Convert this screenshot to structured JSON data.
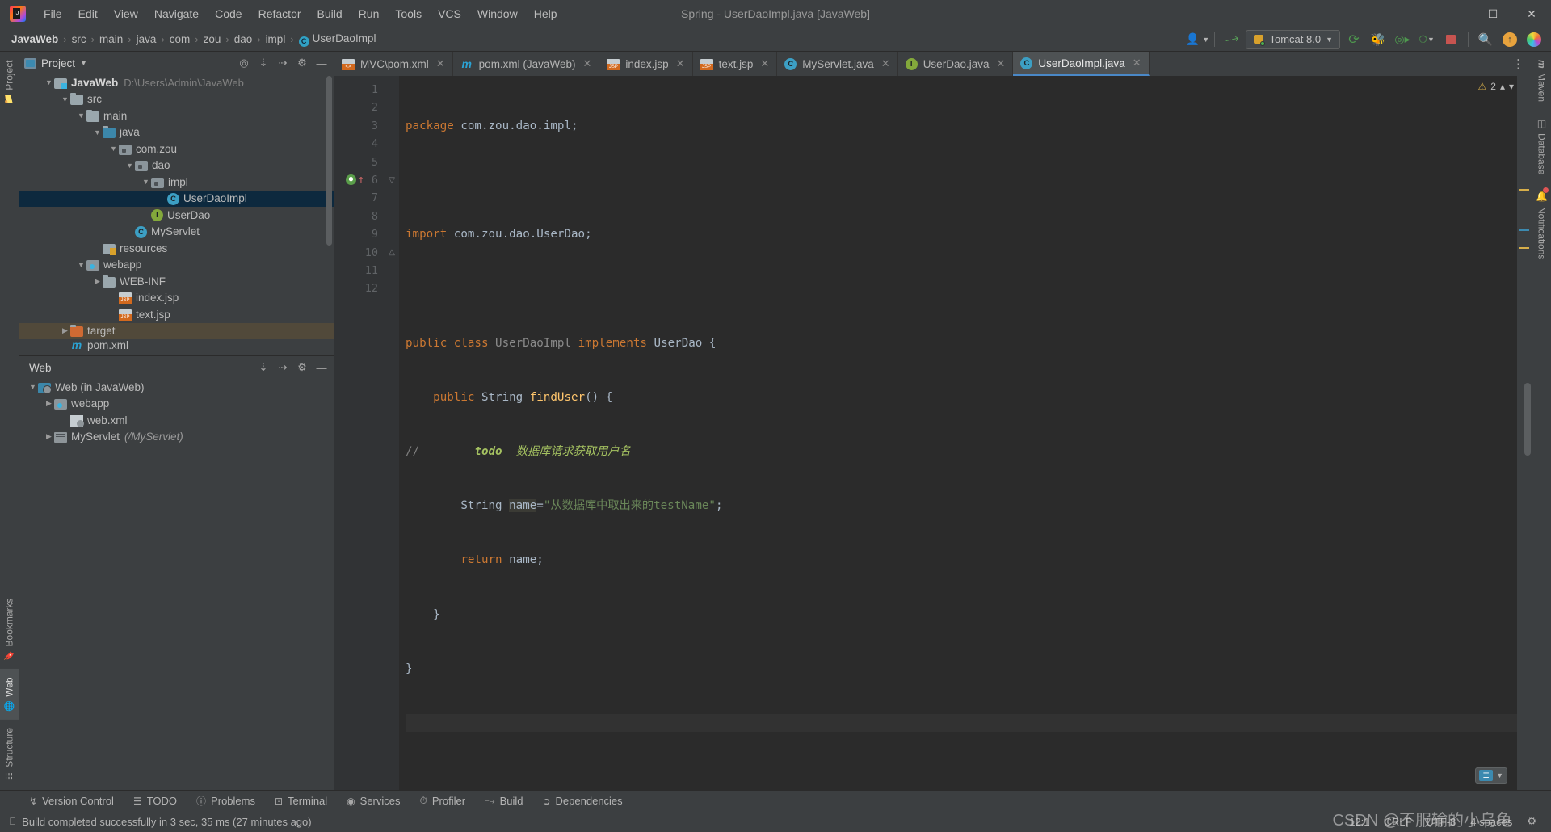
{
  "window": {
    "title": "Spring - UserDaoImpl.java [JavaWeb]",
    "logo_icon": "intellij-idea-logo",
    "minimize_icon": "minimize-icon",
    "maximize_icon": "maximize-icon",
    "close_icon": "close-icon"
  },
  "menubar": {
    "items": [
      {
        "label": "File"
      },
      {
        "label": "Edit"
      },
      {
        "label": "View"
      },
      {
        "label": "Navigate"
      },
      {
        "label": "Code"
      },
      {
        "label": "Refactor"
      },
      {
        "label": "Build"
      },
      {
        "label": "Run"
      },
      {
        "label": "Tools"
      },
      {
        "label": "VCS"
      },
      {
        "label": "Window"
      },
      {
        "label": "Help"
      }
    ]
  },
  "breadcrumb": {
    "items": [
      "JavaWeb",
      "src",
      "main",
      "java",
      "com",
      "zou",
      "dao",
      "impl"
    ],
    "current_file": "UserDaoImpl",
    "current_file_icon_letter": "C",
    "separator": "›"
  },
  "toolbar": {
    "user_icon": "user-account-icon",
    "build_icon": "build-hammer-icon",
    "run_config": {
      "label": "Tomcat 8.0",
      "icon": "tomcat-cat-icon",
      "dropdown_icon": "chevron-down-icon"
    },
    "actions": [
      {
        "name": "run-icon",
        "glyph": "⟳"
      },
      {
        "name": "debug-icon",
        "glyph": "⚙"
      },
      {
        "name": "run-with-coverage-icon",
        "glyph": "▶"
      },
      {
        "name": "profiler-icon",
        "glyph": "◴"
      },
      {
        "name": "stop-icon",
        "glyph": "■"
      },
      {
        "name": "search-everywhere-icon",
        "glyph": "⌕"
      },
      {
        "name": "update-icon",
        "glyph": "↑"
      },
      {
        "name": "idea-assistant-icon",
        "glyph": ""
      }
    ]
  },
  "left_strip": {
    "top": [
      {
        "label": "Project",
        "icon": "project-folder-icon",
        "active": false
      }
    ],
    "bottom": [
      {
        "label": "Bookmarks",
        "icon": "bookmark-icon",
        "active": false
      },
      {
        "label": "Web",
        "icon": "web-globe-icon",
        "active": true
      },
      {
        "label": "Structure",
        "icon": "structure-icon",
        "active": false
      }
    ]
  },
  "right_strip": {
    "items": [
      {
        "label": "Maven",
        "icon": "maven-m-icon",
        "badge": false
      },
      {
        "label": "Database",
        "icon": "database-icon",
        "badge": false
      },
      {
        "label": "Notifications",
        "icon": "bell-icon",
        "badge": true
      }
    ]
  },
  "project_panel": {
    "title": "Project",
    "title_icon": "project-window-icon",
    "dropdown_icon": "chevron-down-icon",
    "actions": [
      {
        "name": "select-opened-file-icon",
        "glyph": "⊕"
      },
      {
        "name": "expand-all-icon",
        "glyph": "⤓"
      },
      {
        "name": "collapse-all-icon",
        "glyph": "⤒"
      },
      {
        "name": "settings-gear-icon",
        "glyph": "⚙"
      },
      {
        "name": "hide-panel-icon",
        "glyph": "—"
      }
    ],
    "tree": [
      {
        "label": "JavaWeb",
        "path": "D:\\Users\\Admin\\JavaWeb",
        "depth": 0,
        "arrow": "down",
        "icon": "module-icon",
        "bold": true
      },
      {
        "label": "src",
        "depth": 1,
        "arrow": "down",
        "icon": "folder-icon"
      },
      {
        "label": "main",
        "depth": 2,
        "arrow": "down",
        "icon": "folder-icon"
      },
      {
        "label": "java",
        "depth": 3,
        "arrow": "down",
        "icon": "source-folder-icon"
      },
      {
        "label": "com.zou",
        "depth": 4,
        "arrow": "down",
        "icon": "package-icon"
      },
      {
        "label": "dao",
        "depth": 5,
        "arrow": "down",
        "icon": "package-icon"
      },
      {
        "label": "impl",
        "depth": 6,
        "arrow": "down",
        "icon": "package-icon"
      },
      {
        "label": "UserDaoImpl",
        "depth": 7,
        "arrow": "none",
        "icon": "java-class-icon",
        "selected": true
      },
      {
        "label": "UserDao",
        "depth": 6,
        "arrow": "none",
        "icon": "java-interface-icon"
      },
      {
        "label": "MyServlet",
        "depth": 5,
        "arrow": "none",
        "icon": "java-class-icon"
      },
      {
        "label": "resources",
        "depth": 3,
        "arrow": "none",
        "icon": "resources-folder-icon"
      },
      {
        "label": "webapp",
        "depth": 3,
        "arrow": "down",
        "icon": "webapp-folder-icon"
      },
      {
        "label": "WEB-INF",
        "depth": 4,
        "arrow": "right",
        "icon": "folder-icon"
      },
      {
        "label": "index.jsp",
        "depth": 4,
        "arrow": "none",
        "icon": "jsp-file-icon"
      },
      {
        "label": "text.jsp",
        "depth": 4,
        "arrow": "none",
        "icon": "jsp-file-icon"
      },
      {
        "label": "target",
        "depth": 1,
        "arrow": "right",
        "icon": "excluded-folder-icon",
        "excluded": true
      },
      {
        "label": "pom.xml",
        "depth": 1,
        "arrow": "none",
        "icon": "maven-file-icon"
      }
    ]
  },
  "web_panel": {
    "title": "Web",
    "actions": [
      {
        "name": "expand-all-icon",
        "glyph": "⤓"
      },
      {
        "name": "collapse-all-icon",
        "glyph": "⤒"
      },
      {
        "name": "settings-gear-icon",
        "glyph": "⚙"
      },
      {
        "name": "hide-panel-icon",
        "glyph": "—"
      }
    ],
    "tree": [
      {
        "label": "Web (in JavaWeb)",
        "depth": 0,
        "arrow": "down",
        "icon": "web-facet-icon"
      },
      {
        "label": "webapp",
        "depth": 1,
        "arrow": "right",
        "icon": "webapp-folder-icon"
      },
      {
        "label": "web.xml",
        "depth": 1,
        "arrow": "none",
        "icon": "web-xml-icon"
      },
      {
        "label": "MyServlet",
        "sub": "(/MyServlet)",
        "depth": 1,
        "arrow": "right",
        "icon": "servlet-icon"
      }
    ]
  },
  "editor_tabs": {
    "tabs": [
      {
        "label": "MVC\\pom.xml",
        "icon": "xml-file-icon",
        "active": false
      },
      {
        "label": "pom.xml (JavaWeb)",
        "icon": "maven-file-icon",
        "active": false
      },
      {
        "label": "index.jsp",
        "icon": "jsp-file-icon",
        "active": false
      },
      {
        "label": "text.jsp",
        "icon": "jsp-file-icon",
        "active": false
      },
      {
        "label": "MyServlet.java",
        "icon": "java-class-icon",
        "active": false
      },
      {
        "label": "UserDao.java",
        "icon": "java-interface-icon",
        "active": false
      },
      {
        "label": "UserDaoImpl.java",
        "icon": "java-class-icon",
        "active": true
      }
    ],
    "close_glyph": "×",
    "more_icon": "more-options-icon"
  },
  "editor": {
    "line_numbers": [
      "1",
      "2",
      "3",
      "4",
      "5",
      "6",
      "7",
      "8",
      "9",
      "10",
      "11",
      "12"
    ],
    "current_line": 12,
    "gutter_markers": {
      "line6_run": "run-method-icon",
      "line6_override": "implementing-method-icon",
      "line6_fold": "fold-collapse-icon",
      "line10_fold": "fold-end-icon"
    },
    "lines": [
      {
        "n": 1,
        "tokens": [
          {
            "t": "package",
            "c": "kw"
          },
          {
            "t": " com.zou.dao.impl;",
            "c": "pl"
          }
        ]
      },
      {
        "n": 2,
        "tokens": []
      },
      {
        "n": 3,
        "tokens": [
          {
            "t": "import",
            "c": "kw"
          },
          {
            "t": " com.zou.dao.UserDao;",
            "c": "pl"
          }
        ]
      },
      {
        "n": 4,
        "tokens": []
      },
      {
        "n": 5,
        "tokens": [
          {
            "t": "public class",
            "c": "kw"
          },
          {
            "t": " ",
            "c": "pl"
          },
          {
            "t": "UserDaoImpl",
            "c": "dim"
          },
          {
            "t": " ",
            "c": "pl"
          },
          {
            "t": "implements",
            "c": "kw"
          },
          {
            "t": " UserDao {",
            "c": "pl"
          }
        ]
      },
      {
        "n": 6,
        "tokens": [
          {
            "t": "    ",
            "c": "pl"
          },
          {
            "t": "public",
            "c": "kw"
          },
          {
            "t": " String ",
            "c": "pl"
          },
          {
            "t": "findUser",
            "c": "mth"
          },
          {
            "t": "() {",
            "c": "pl"
          }
        ]
      },
      {
        "n": 7,
        "tokens": [
          {
            "t": "//",
            "c": "cmt"
          },
          {
            "t": "        ",
            "c": "pl"
          },
          {
            "t": "todo",
            "c": "todo"
          },
          {
            "t": "  数据库请求获取用户名",
            "c": "todotxt"
          }
        ]
      },
      {
        "n": 8,
        "tokens": [
          {
            "t": "        String ",
            "c": "pl"
          },
          {
            "t": "name",
            "c": "ident-hl"
          },
          {
            "t": "=",
            "c": "pl"
          },
          {
            "t": "\"从数据库中取出来的testName\"",
            "c": "str"
          },
          {
            "t": ";",
            "c": "pl"
          }
        ]
      },
      {
        "n": 9,
        "tokens": [
          {
            "t": "        ",
            "c": "pl"
          },
          {
            "t": "return",
            "c": "kw"
          },
          {
            "t": " name;",
            "c": "pl"
          }
        ]
      },
      {
        "n": 10,
        "tokens": [
          {
            "t": "    }",
            "c": "pl"
          }
        ]
      },
      {
        "n": 11,
        "tokens": [
          {
            "t": "}",
            "c": "pl"
          }
        ]
      },
      {
        "n": 12,
        "tokens": []
      }
    ],
    "inspection": {
      "warning_count": "2",
      "warning_icon": "warning-triangle-icon",
      "prev_icon": "chevron-up-icon",
      "next_icon": "chevron-down-icon"
    },
    "zoom_widget": {
      "icon": "editor-mode-icon",
      "dropdown_icon": "chevron-down-icon"
    }
  },
  "bottom_bar": {
    "buttons": [
      {
        "label": "Version Control",
        "icon": "branch-icon"
      },
      {
        "label": "TODO",
        "icon": "todo-list-icon"
      },
      {
        "label": "Problems",
        "icon": "problems-icon"
      },
      {
        "label": "Terminal",
        "icon": "terminal-icon"
      },
      {
        "label": "Services",
        "icon": "services-icon"
      },
      {
        "label": "Profiler",
        "icon": "profiler-icon"
      },
      {
        "label": "Build",
        "icon": "build-hammer-icon"
      },
      {
        "label": "Dependencies",
        "icon": "dependencies-icon"
      }
    ]
  },
  "status_bar": {
    "message_icon": "build-status-icon",
    "message": "Build completed successfully in 3 sec, 35 ms (27 minutes ago)",
    "caret_position": "12:1",
    "line_separator": "CRLF",
    "encoding": "UTF-8",
    "indent": "4 spaces",
    "watermark": "CSDN @不服输的小乌龟",
    "settings_icon": "settings-gear-icon"
  },
  "colors": {
    "panel_bg": "#3c3f41",
    "editor_bg": "#2b2b2b",
    "gutter_bg": "#313335",
    "selection_blue": "#0d293e",
    "excluded_brown": "#51493a",
    "accent_blue": "#4a88c7",
    "keyword_orange": "#cc7832",
    "string_green": "#6a8759",
    "method_yellow": "#ffc66d",
    "todo_green": "#a5c261"
  }
}
